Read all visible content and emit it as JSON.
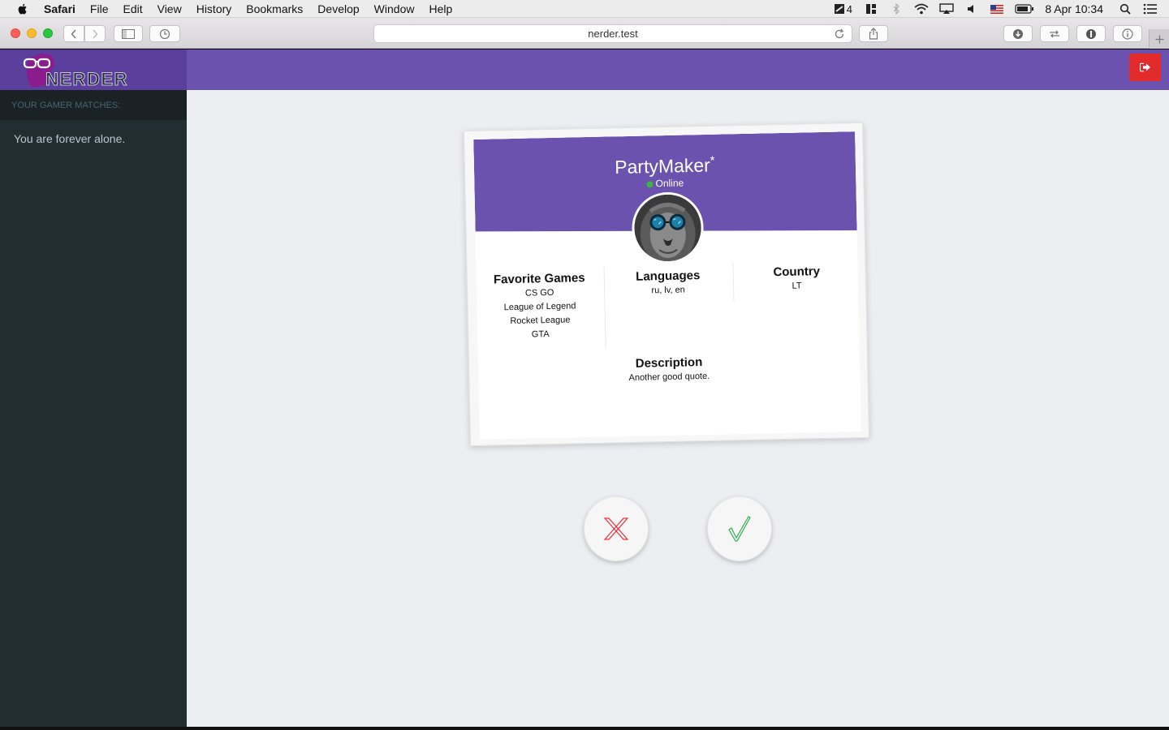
{
  "menubar": {
    "app_name": "Safari",
    "items": [
      "File",
      "Edit",
      "View",
      "History",
      "Bookmarks",
      "Develop",
      "Window",
      "Help"
    ],
    "badge_count": "4",
    "clock": "8 Apr  10:34"
  },
  "browser": {
    "url": "nerder.test"
  },
  "app": {
    "logo_text": "NERDER",
    "accent_color": "#6b52ae",
    "logout_color": "#e32b2b"
  },
  "sidebar": {
    "header": "YOUR GAMER MATCHES:",
    "empty_text": "You are forever alone."
  },
  "profile": {
    "name": "PartyMaker",
    "name_mark": "*",
    "status": "Online",
    "favorite_games_label": "Favorite Games",
    "favorite_games": [
      "CS GO",
      "League of Legend",
      "Rocket League",
      "GTA"
    ],
    "languages_label": "Languages",
    "languages": "ru, lv, en",
    "country_label": "Country",
    "country": "LT",
    "description_label": "Description",
    "description": "Another good quote."
  },
  "actions": {
    "reject_icon": "x-icon",
    "accept_icon": "check-icon",
    "reject_color": "#e8323c",
    "accept_color": "#2fae55"
  }
}
